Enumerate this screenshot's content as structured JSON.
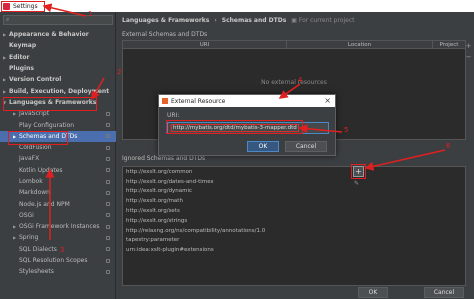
{
  "window": {
    "title": "Settings"
  },
  "sidebar": {
    "search_placeholder": "",
    "items": [
      {
        "label": "Appearance & Behavior",
        "bold": true,
        "arrow": "▶",
        "indent": 0
      },
      {
        "label": "Keymap",
        "bold": true,
        "arrow": "",
        "indent": 0
      },
      {
        "label": "Editor",
        "bold": true,
        "arrow": "▶",
        "indent": 0
      },
      {
        "label": "Plugins",
        "bold": true,
        "arrow": "",
        "indent": 0
      },
      {
        "label": "Version Control",
        "bold": true,
        "arrow": "▶",
        "indent": 0
      },
      {
        "label": "Build, Execution, Deployment",
        "bold": true,
        "arrow": "▶",
        "indent": 0
      },
      {
        "label": "Languages & Frameworks",
        "bold": true,
        "arrow": "▼",
        "indent": 0
      },
      {
        "label": "JavaScript",
        "bold": false,
        "arrow": "▶",
        "indent": 1
      },
      {
        "label": "Play Configuration",
        "bold": false,
        "arrow": "",
        "indent": 1
      },
      {
        "label": "Schemas and DTDs",
        "bold": false,
        "arrow": "▶",
        "indent": 1,
        "selected": true
      },
      {
        "label": "ColdFusion",
        "bold": false,
        "arrow": "",
        "indent": 1
      },
      {
        "label": "JavaFX",
        "bold": false,
        "arrow": "",
        "indent": 1
      },
      {
        "label": "Kotlin Updates",
        "bold": false,
        "arrow": "",
        "indent": 1
      },
      {
        "label": "Lombok",
        "bold": false,
        "arrow": "",
        "indent": 1
      },
      {
        "label": "Markdown",
        "bold": false,
        "arrow": "",
        "indent": 1
      },
      {
        "label": "Node.js and NPM",
        "bold": false,
        "arrow": "",
        "indent": 1
      },
      {
        "label": "OSGi",
        "bold": false,
        "arrow": "",
        "indent": 1
      },
      {
        "label": "OSGi Framework Instances",
        "bold": false,
        "arrow": "▶",
        "indent": 1
      },
      {
        "label": "Spring",
        "bold": false,
        "arrow": "▶",
        "indent": 1
      },
      {
        "label": "SQL Dialects",
        "bold": false,
        "arrow": "",
        "indent": 1
      },
      {
        "label": "SQL Resolution Scopes",
        "bold": false,
        "arrow": "",
        "indent": 1
      },
      {
        "label": "Stylesheets",
        "bold": false,
        "arrow": "",
        "indent": 1
      }
    ]
  },
  "breadcrumb": {
    "parent": "Languages & Frameworks",
    "separator": "›",
    "current": "Schemas and DTDs",
    "note": "For current project"
  },
  "external_schemas": {
    "title": "External Schemas and DTDs",
    "columns": [
      "URI",
      "Location",
      "Project"
    ],
    "empty_text": "No external resources"
  },
  "ignored_schemas": {
    "title": "Ignored Schemas and DTDs",
    "items": [
      "http://exslt.org/common",
      "http://exslt.org/dates-and-times",
      "http://exslt.org/dynamic",
      "http://exslt.org/math",
      "http://exslt.org/sets",
      "http://exslt.org/strings",
      "http://relaxng.org/ns/compatibility/annotations/1.0",
      "tapestry:parameter",
      "urn:idea:xslt-plugin#extensions"
    ]
  },
  "dialog": {
    "title": "External Resource",
    "uri_label": "URI:",
    "uri_value": "http://mybatis.org/dtd/mybatis-3-mapper.dtd",
    "ok_label": "OK",
    "cancel_label": "Cancel"
  },
  "bottom_buttons": {
    "ok": "OK",
    "cancel": "Cancel"
  },
  "annotations": [
    "1",
    "2",
    "3",
    "4",
    "5",
    "6"
  ],
  "colors": {
    "selection": "#4b6eaf",
    "annotation": "#e02020",
    "background": "#3c3f41",
    "accent": "#4a88c7"
  }
}
